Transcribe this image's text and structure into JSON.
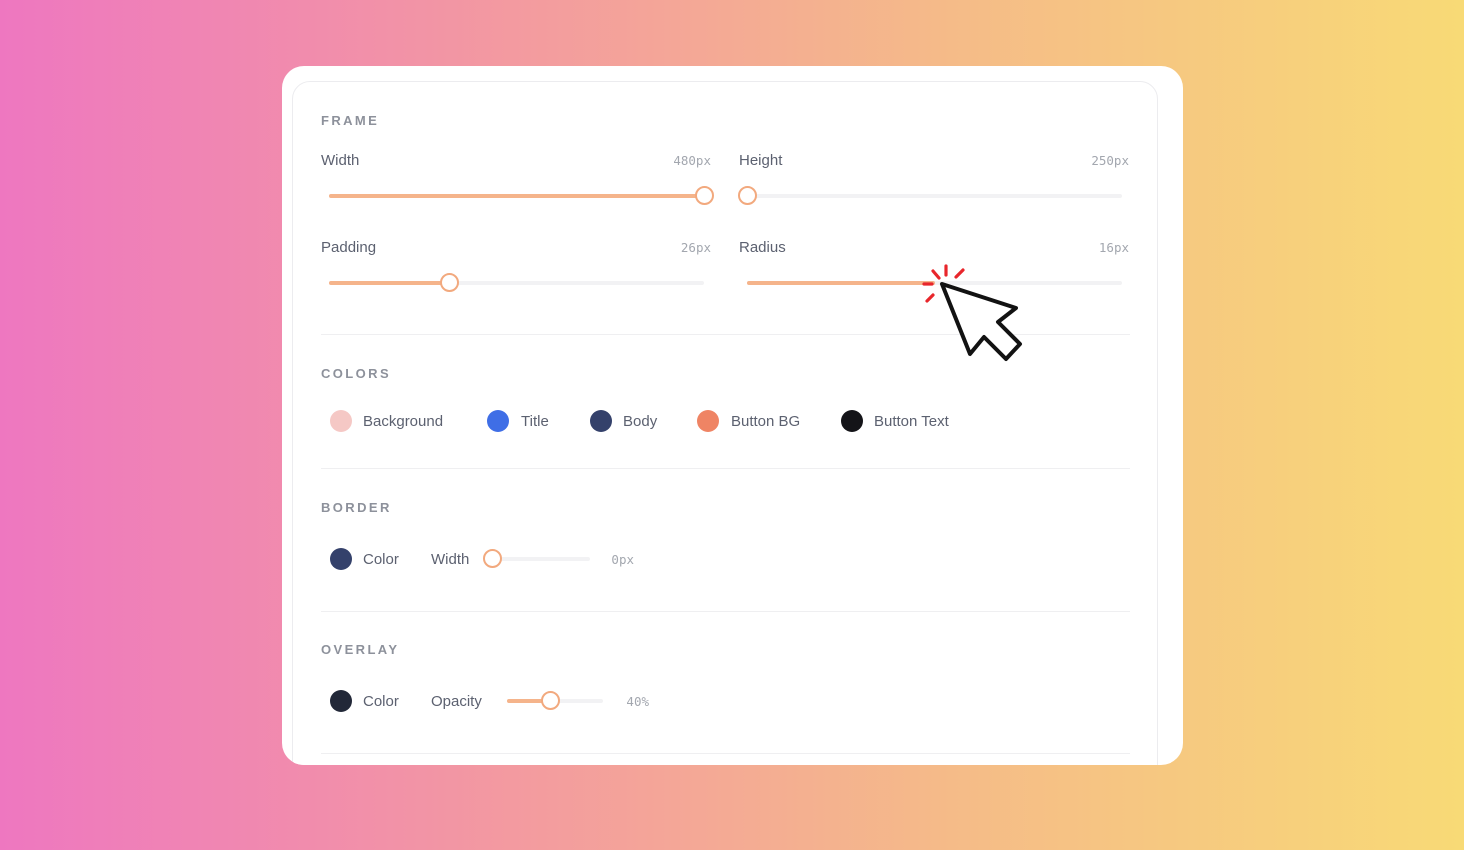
{
  "frame": {
    "title": "FRAME",
    "width": {
      "label": "Width",
      "value": "480px",
      "fill": 1.0
    },
    "height": {
      "label": "Height",
      "value": "250px",
      "fill": 0.0
    },
    "padding": {
      "label": "Padding",
      "value": "26px",
      "fill": 0.32
    },
    "radius": {
      "label": "Radius",
      "value": "16px",
      "fill": 0.5
    }
  },
  "colors": {
    "title": "COLORS",
    "items": [
      {
        "label": "Background",
        "color": "#f5c8c5"
      },
      {
        "label": "Title",
        "color": "#3f6ee6"
      },
      {
        "label": "Body",
        "color": "#34416b"
      },
      {
        "label": "Button BG",
        "color": "#ef8464"
      },
      {
        "label": "Button Text",
        "color": "#141418"
      }
    ]
  },
  "border": {
    "title": "BORDER",
    "color_label": "Color",
    "color": "#34416b",
    "width_label": "Width",
    "width_value": "0px",
    "fill": 0.0
  },
  "overlay": {
    "title": "OVERLAY",
    "color_label": "Color",
    "color": "#222838",
    "opacity_label": "Opacity",
    "opacity_value": "40%",
    "fill": 0.45
  },
  "colors_accent": {
    "slider_fill": "#f5b48b",
    "thumb_border": "#f2a97e",
    "click_burst": "#e8262b"
  },
  "icons": {
    "cursor": "pointer-cursor-icon"
  }
}
